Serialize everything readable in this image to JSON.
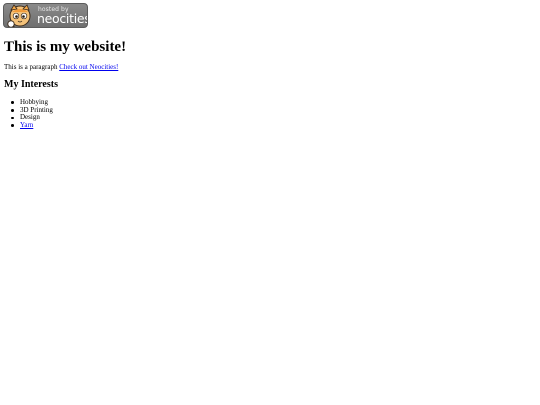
{
  "badge": {
    "hosted_label": "hosted by",
    "brand_label": "neocities",
    "mascot_icon": "neocities-cat-mascot-icon"
  },
  "page": {
    "title": "This is my website!",
    "paragraph_text": "This is a paragraph",
    "link_label": "Check out Neocities!",
    "interests_heading": "My Interests",
    "interests": [
      {
        "label": "Hobbying",
        "is_link": false
      },
      {
        "label": "3D Printing",
        "is_link": false
      },
      {
        "label": "Design",
        "is_link": false
      },
      {
        "label": "Yarn",
        "is_link": true
      }
    ]
  },
  "colors": {
    "link": "#0000ee",
    "badge_bg": "#7a7a7a",
    "text": "#000000"
  }
}
